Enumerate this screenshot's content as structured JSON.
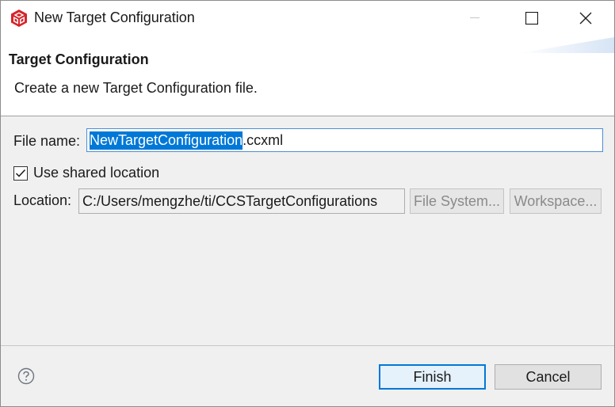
{
  "window": {
    "title": "New Target Configuration",
    "app_icon": "ccs-cube-icon",
    "controls": [
      "minimize-icon",
      "maximize-icon",
      "close-icon"
    ]
  },
  "banner": {
    "title": "Target Configuration",
    "message": "Create a new Target Configuration file."
  },
  "form": {
    "file_name_label": "File name:",
    "file_name_selected": "NewTargetConfiguration",
    "file_name_suffix": ".ccxml",
    "use_shared_label": "Use shared location",
    "use_shared_checked": true,
    "location_label": "Location:",
    "location_value": "C:/Users/mengzhe/ti/CCSTargetConfigurations",
    "file_system_button": "File System...",
    "workspace_button": "Workspace..."
  },
  "footer": {
    "help_icon": "help-icon",
    "finish_button": "Finish",
    "cancel_button": "Cancel"
  },
  "colors": {
    "selection": "#0078d7",
    "default_button_border": "#0078d7",
    "app_icon_red": "#d8232a"
  }
}
